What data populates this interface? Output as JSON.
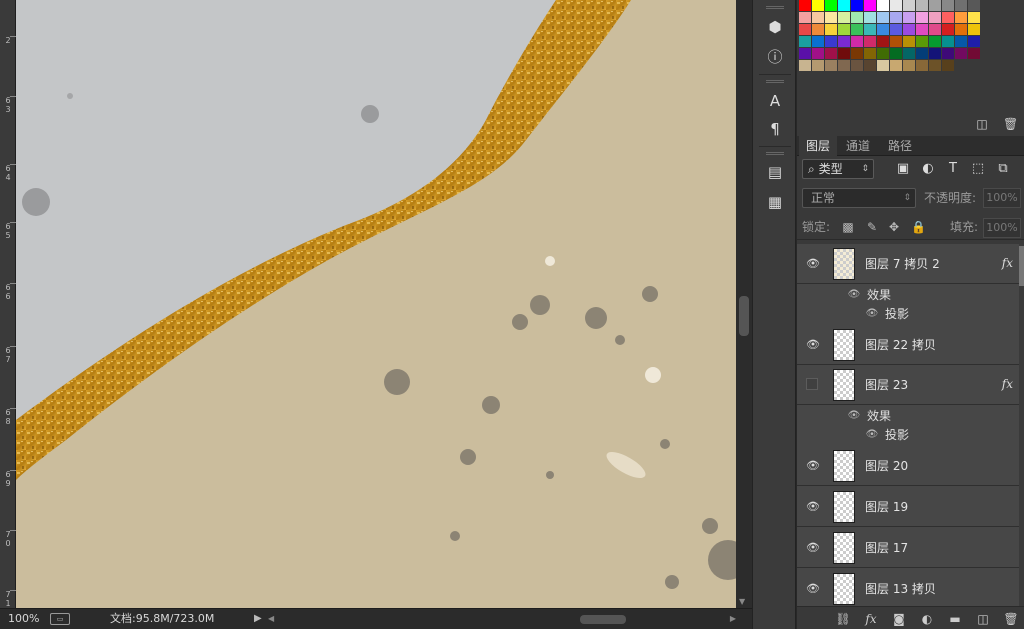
{
  "status": {
    "zoom": "100%",
    "doc_info": "文档:95.8M/723.0M",
    "preview_icon": "film-icon",
    "play_icon": "play-icon"
  },
  "ruler": {
    "labels": [
      "2",
      "6\n3",
      "6\n4",
      "6\n5",
      "6\n6",
      "6\n7",
      "6\n8",
      "6\n9",
      "7\n0",
      "7\n1"
    ]
  },
  "toolbar": {
    "items": [
      "3d-tool-icon",
      "info-icon",
      "character-icon",
      "paragraph-icon",
      "notes-icon",
      "history-icon"
    ]
  },
  "swatches": {
    "rows": [
      [
        "#ff0000",
        "#ffff00",
        "#00ff00",
        "#00ffff",
        "#0000ff",
        "#ff00ff",
        "#ffffff",
        "#e8e8e8",
        "#d0d0d0",
        "#b8b8b8",
        "#a0a0a0",
        "#888888",
        "#707070",
        "#585858"
      ],
      [
        "#f4a0a0",
        "#f7c8a0",
        "#fbe7a0",
        "#d8f0a0",
        "#a0e8b0",
        "#a0e0e0",
        "#a0c8f0",
        "#a8a8f0",
        "#c8a0f0",
        "#f0a0e0",
        "#f0a0c0",
        "#ff6060",
        "#ff9d3c",
        "#ffe14a"
      ],
      [
        "#e84848",
        "#ee8a3a",
        "#f6d33a",
        "#9fd83a",
        "#3ac05a",
        "#3ab7b7",
        "#3a8ae0",
        "#5a5ae0",
        "#9a4ae0",
        "#e04ac0",
        "#e04a8a",
        "#d41f1f",
        "#e26f0a",
        "#edc30a"
      ],
      [
        "#1aa0a0",
        "#0a70d0",
        "#3a3ad0",
        "#7a2ad0",
        "#d02aa8",
        "#d02a6a",
        "#a01414",
        "#b05006",
        "#b89006",
        "#5a9a06",
        "#069a30",
        "#069090",
        "#0658a8",
        "#1e1ea8"
      ],
      [
        "#5a10a8",
        "#a01088",
        "#a0104a",
        "#700c0c",
        "#7a3804",
        "#826504",
        "#406c04",
        "#046c22",
        "#046666",
        "#043d78",
        "#141478",
        "#3e0a78",
        "#720a60",
        "#720a34"
      ],
      [
        "#c8b490",
        "#b49a70",
        "#9a8060",
        "#806850",
        "#6a5440",
        "#584430",
        "#d8c8a0",
        "#c8a870",
        "#a88850",
        "#886838",
        "#6c5228",
        "#58401c",
        "",
        ""
      ]
    ]
  },
  "panel": {
    "tabs": [
      "图层",
      "通道",
      "路径"
    ],
    "filter": {
      "label": "类型",
      "icons": [
        "image-filter-icon",
        "adjustment-filter-icon",
        "type-filter-icon",
        "shape-filter-icon",
        "smart-object-filter-icon"
      ]
    },
    "blend": {
      "mode": "正常",
      "opacity_label": "不透明度:",
      "opacity_value": "100%"
    },
    "lock": {
      "label": "锁定:",
      "fill_label": "填充:",
      "fill_value": "100%"
    },
    "layers": [
      {
        "name": "图层 7 拷贝 2",
        "visible": true,
        "fx": true
      },
      {
        "name": "图层 22 拷贝",
        "visible": true,
        "fx": false
      },
      {
        "name": "图层 23",
        "visible": false,
        "fx": true
      },
      {
        "name": "图层 20",
        "visible": true,
        "fx": false
      },
      {
        "name": "图层 19",
        "visible": true,
        "fx": false
      },
      {
        "name": "图层 17",
        "visible": true,
        "fx": false
      },
      {
        "name": "图层 13 拷贝",
        "visible": true,
        "fx": false
      }
    ],
    "effects_label": "效果",
    "drop_shadow_label": "投影",
    "fx_label": "fx"
  }
}
